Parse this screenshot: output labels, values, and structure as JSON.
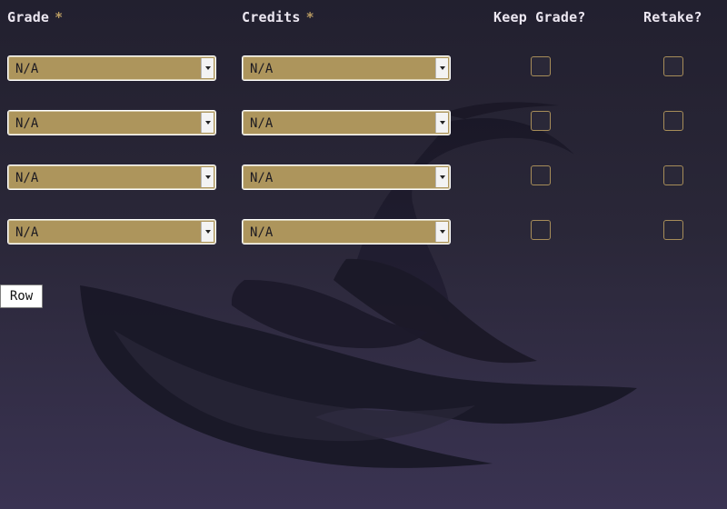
{
  "headers": {
    "grade": "Grade",
    "credits": "Credits",
    "required_marker": "*",
    "keep_grade": "Keep Grade?",
    "retake": "Retake?"
  },
  "rows": [
    {
      "grade": "N/A",
      "credits": "N/A",
      "keep_grade": false,
      "retake": false
    },
    {
      "grade": "N/A",
      "credits": "N/A",
      "keep_grade": false,
      "retake": false
    },
    {
      "grade": "N/A",
      "credits": "N/A",
      "keep_grade": false,
      "retake": false
    },
    {
      "grade": "N/A",
      "credits": "N/A",
      "keep_grade": false,
      "retake": false
    }
  ],
  "actions": {
    "add_row_label": "Row"
  },
  "colors": {
    "background_top": "#22202f",
    "background_bottom": "#3a3352",
    "select_fill": "#ad955c",
    "required_marker": "#b89a62",
    "checkbox_border": "#a78d59"
  },
  "icons": {
    "background_graphic": "wizard-hat-icon",
    "select_arrow": "chevron-down-icon"
  }
}
